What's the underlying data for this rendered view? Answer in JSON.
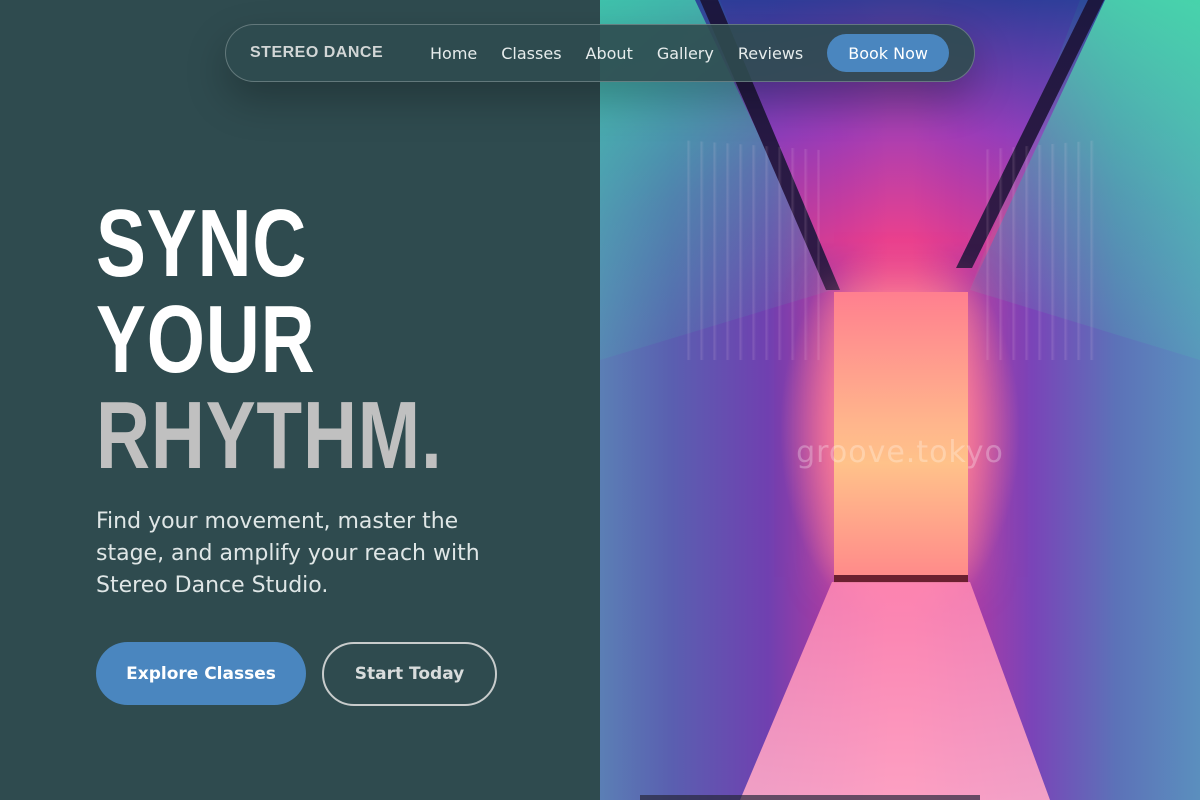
{
  "nav": {
    "brand": "STEREO DANCE",
    "links": [
      "Home",
      "Classes",
      "About",
      "Gallery",
      "Reviews"
    ],
    "cta": "Book Now"
  },
  "hero": {
    "headline": [
      "SYNC",
      "YOUR",
      "RHYTHM."
    ],
    "subtitle": "Find your movement, master the stage, and amplify your reach with Stereo Dance Studio.",
    "primary_button": "Explore Classes",
    "secondary_button": "Start Today"
  },
  "image": {
    "watermark": "groove.tokyo",
    "description_icon": "neon-corridor-image"
  },
  "colors": {
    "background": "#2f4b4f",
    "accent": "#4a86bf",
    "headline_muted": "#c0c0c0"
  }
}
